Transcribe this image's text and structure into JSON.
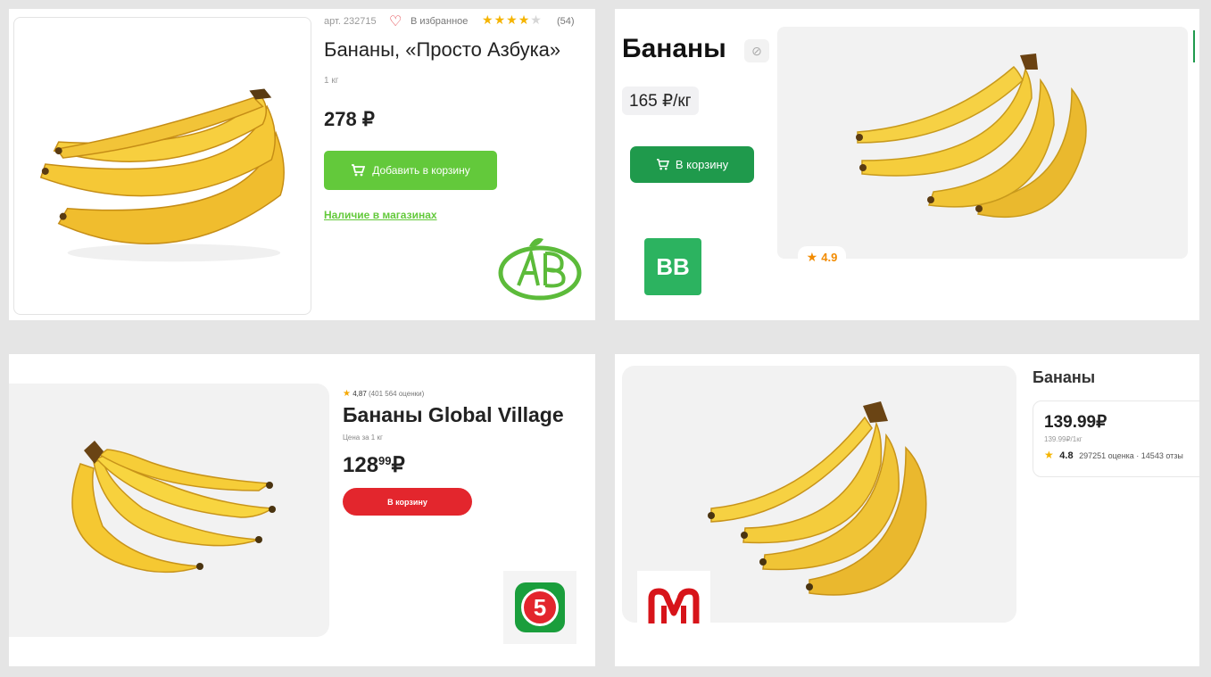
{
  "azbuka": {
    "article": "арт. 232715",
    "favorite": "В избранное",
    "reviews": "(54)",
    "rating_stars": 4,
    "title": "Бананы, «Просто Азбука»",
    "weight": "1 кг",
    "price": "278 ₽",
    "add_to_cart": "Добавить в корзину",
    "availability": "Наличие в магазинах",
    "brand_color": "#5cbb3a"
  },
  "vkusvill": {
    "title": "Бананы",
    "price": "165 ₽/кг",
    "add_to_cart": "В корзину",
    "logo_text": "ВВ",
    "rating": "4.9",
    "brand_color": "#1f9a4c"
  },
  "pyaterochka": {
    "rating": "4,87",
    "rating_count": "(401 564 оценки)",
    "title": "Бананы Global Village",
    "price_label": "Цена за 1 кг",
    "price_main": "128",
    "price_cents": "99",
    "price_currency": "₽",
    "add_to_cart": "В корзину",
    "logo_text": "5",
    "brand_color": "#e3262d"
  },
  "magnit": {
    "title": "Бананы",
    "price": "139.99₽",
    "old_price": "139.99₽/1кг",
    "rating": "4.8",
    "rating_details": "297251 оценка · 14543 отзы",
    "logo_text": "М",
    "brand_color": "#d7141a"
  }
}
